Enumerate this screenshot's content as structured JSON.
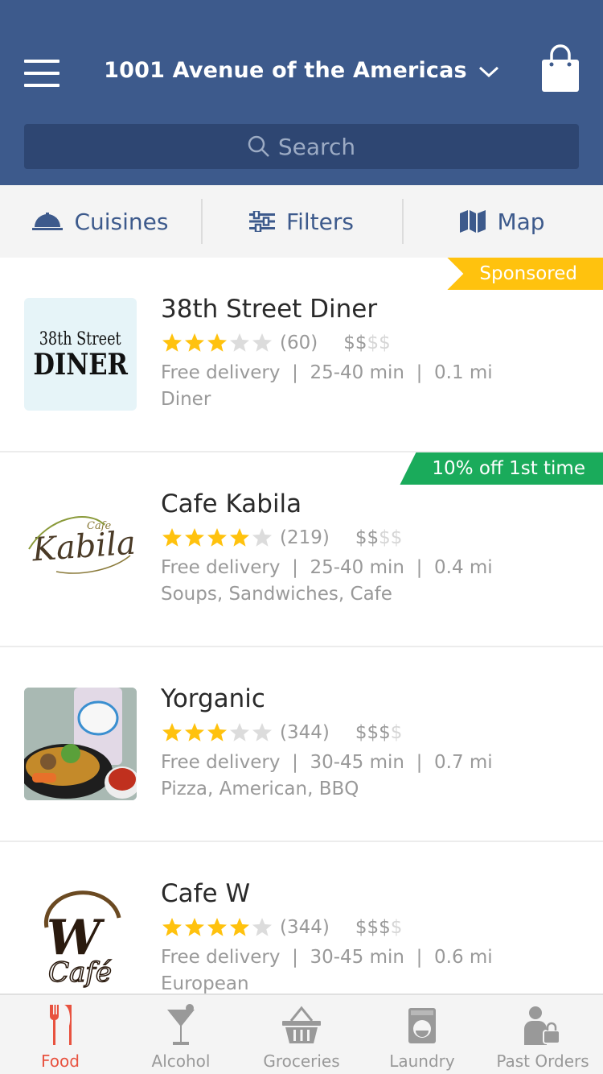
{
  "header": {
    "address": "1001 Avenue of the Americas",
    "search_placeholder": "Search"
  },
  "filterbar": {
    "cuisines": "Cuisines",
    "filters": "Filters",
    "map": "Map"
  },
  "restaurants": [
    {
      "name": "38th Street Diner",
      "rating": 3,
      "reviews": "(60)",
      "price_on": "$$",
      "price_off": "$$",
      "delivery": "Free delivery",
      "time": "25-40 min",
      "distance": "0.1 mi",
      "cuisine": "Diner",
      "badge": "Sponsored",
      "logo_line1": "38th Street",
      "logo_line2": "DINER"
    },
    {
      "name": "Cafe Kabila",
      "rating": 4,
      "reviews": "(219)",
      "price_on": "$$",
      "price_off": "$$",
      "delivery": "Free delivery",
      "time": "25-40 min",
      "distance": "0.4 mi",
      "cuisine": "Soups, Sandwiches, Cafe",
      "badge": "10% off 1st time",
      "logo_small": "Cafe",
      "logo_main": "Kabila"
    },
    {
      "name": "Yorganic",
      "rating": 3,
      "reviews": "(344)",
      "price_on": "$$$",
      "price_off": "$",
      "delivery": "Free delivery",
      "time": "30-45 min",
      "distance": "0.7 mi",
      "cuisine": "Pizza, American, BBQ"
    },
    {
      "name": "Cafe W",
      "rating": 4,
      "reviews": "(344)",
      "price_on": "$$$",
      "price_off": "$",
      "delivery": "Free delivery",
      "time": "30-45 min",
      "distance": "0.6 mi",
      "cuisine": "European",
      "logo_letter": "W",
      "logo_word": "Café"
    }
  ],
  "nav": {
    "food": "Food",
    "alcohol": "Alcohol",
    "groceries": "Groceries",
    "laundry": "Laundry",
    "past_orders": "Past Orders"
  },
  "colors": {
    "brand": "#3d5a8c",
    "star": "#ffc20e",
    "sponsored": "#ffc20e",
    "promo": "#1aab5b",
    "active_nav": "#e8523f"
  }
}
